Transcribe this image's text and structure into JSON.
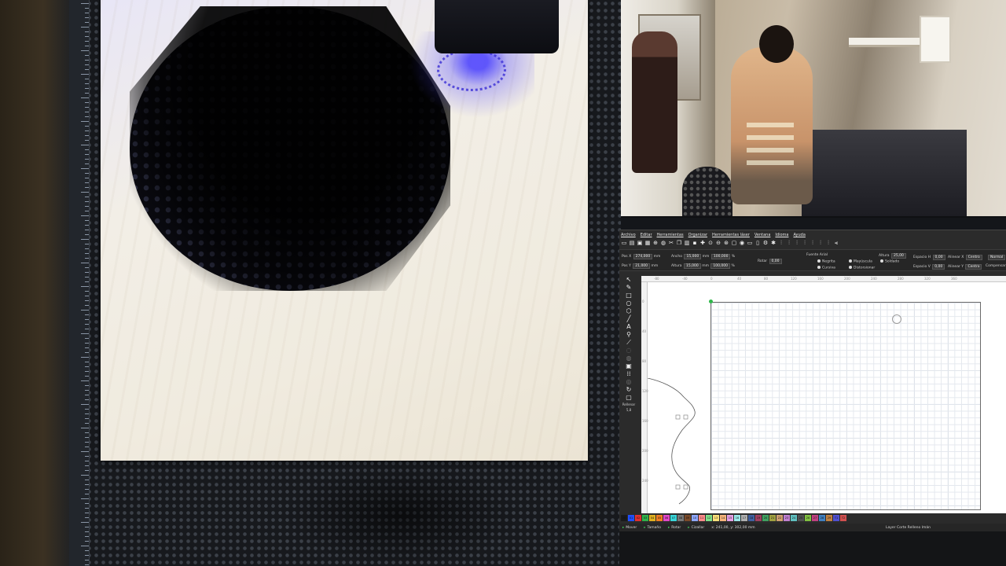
{
  "app": {
    "menu": [
      "Archivo",
      "Editar",
      "Herramientas",
      "Organizar",
      "Herramientas láser",
      "Ventana",
      "Idioma",
      "Ayuda"
    ],
    "properties": {
      "pos_x_label": "Pos X",
      "pos_x_value": "274,000",
      "pos_x_unit": "mm",
      "pos_y_label": "Pos Y",
      "pos_y_value": "21,000",
      "pos_y_unit": "mm",
      "width_label": "Ancho",
      "width_value": "15,000",
      "width_unit": "mm",
      "width_pct": "100,000",
      "height_label": "Altura",
      "height_value": "15,000",
      "height_unit": "mm",
      "height_pct": "100,000",
      "rotate_label": "Rotar",
      "rotate_value": "0,00",
      "font_label": "Fuente",
      "font_value": "Arial",
      "text_height_label": "Altura",
      "text_height_value": "25,00",
      "opt_bold": "Negrita",
      "opt_italic": "Cursiva",
      "opt_upper": "Mayúscula",
      "opt_distort": "Distorsionar",
      "opt_welded": "Soldado",
      "hspace_label": "Espacio H",
      "hspace_value": "0,00",
      "vspace_label": "Espacio V",
      "vspace_value": "0,00",
      "align_x_label": "Alinear X",
      "align_x_value": "Centro",
      "align_y_label": "Alinear Y",
      "align_y_value": "Centro",
      "normal_value": "Normal",
      "offset_value": "Compensar"
    },
    "tool_label_top": "Rellenar",
    "tool_label_value": "5,8",
    "ruler_top": [
      "-80",
      "-40",
      "0",
      "40",
      "80",
      "120",
      "160",
      "200",
      "240",
      "280",
      "320",
      "360"
    ],
    "ruler_left": [
      "0",
      "40",
      "80",
      "120",
      "160",
      "200",
      "240"
    ],
    "palette": [
      "00",
      "01",
      "02",
      "03",
      "04",
      "05",
      "06",
      "07",
      "08",
      "09",
      "10",
      "11",
      "12",
      "13",
      "14",
      "15",
      "16",
      "17",
      "18",
      "19",
      "20",
      "21",
      "22",
      "23",
      "24",
      "25",
      "26",
      "27",
      "28",
      "29",
      "T1",
      "T2"
    ],
    "palette_colors": [
      "#1b1b1b",
      "#1f4fff",
      "#e03030",
      "#2fb14a",
      "#e0b020",
      "#f07d22",
      "#e048c8",
      "#3ad5d9",
      "#777777",
      "#7a4a2a",
      "#8fa8ff",
      "#ff8a8a",
      "#7fe08a",
      "#ffe07a",
      "#f6b47a",
      "#e6a0e6",
      "#9ae8ea",
      "#b0b0b0",
      "#4060a0",
      "#a04060",
      "#40a060",
      "#a0a040",
      "#d0a070",
      "#c080d0",
      "#60c0c0",
      "#505050",
      "#80c040",
      "#c04080",
      "#4080c0",
      "#c08040",
      "#5050d0",
      "#d05050"
    ],
    "status": {
      "move": "Mover",
      "size": "Tamaño",
      "rotate": "Rotar",
      "shear": "Cizallar",
      "coords": "x: 241,00, y: 302,00 mm",
      "layer": "Layer Corte Relleno Imán"
    }
  }
}
